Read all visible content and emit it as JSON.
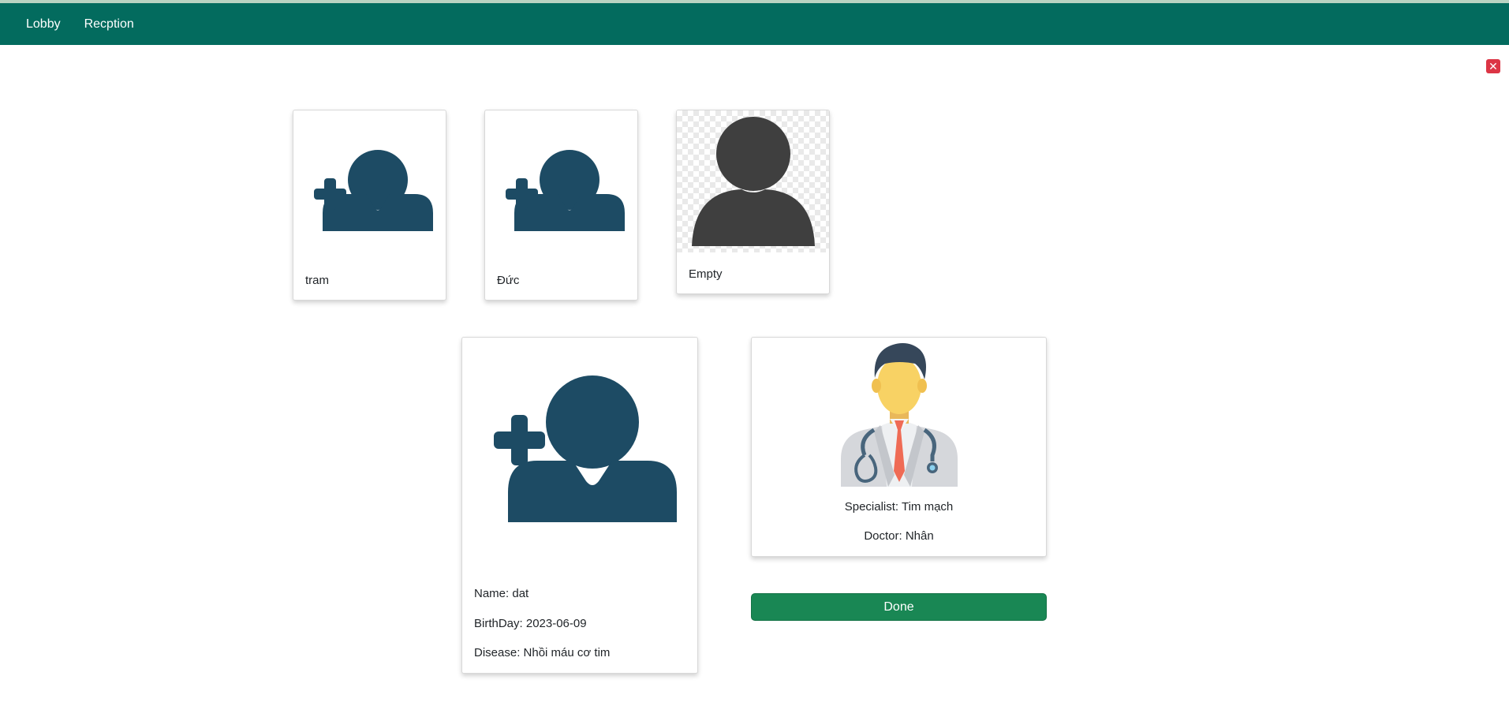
{
  "nav": {
    "items": [
      {
        "label": "Lobby"
      },
      {
        "label": "Recption"
      }
    ]
  },
  "close_button": {
    "icon": "close-icon",
    "symbol": "✕",
    "color": "#dc3545"
  },
  "patients": [
    {
      "name": "tram",
      "icon": "add-user-icon"
    },
    {
      "name": "Đức",
      "icon": "add-user-icon"
    },
    {
      "name": "Empty",
      "icon": "user-silhouette-icon"
    }
  ],
  "selected_patient": {
    "icon": "add-user-icon",
    "name_line": "Name: dat",
    "birthday_line": "BirthDay: 2023-06-09",
    "disease_line": "Disease: Nhồi máu cơ tim"
  },
  "doctor": {
    "icon": "doctor-icon",
    "specialist_line": "Specialist: Tim mạch",
    "doctor_line": "Doctor: Nhân"
  },
  "done_button": {
    "label": "Done",
    "color": "#198754"
  },
  "colors": {
    "navbar": "#036b5e",
    "icon_primary": "#1d4b64",
    "silhouette": "#3f3f3f"
  }
}
